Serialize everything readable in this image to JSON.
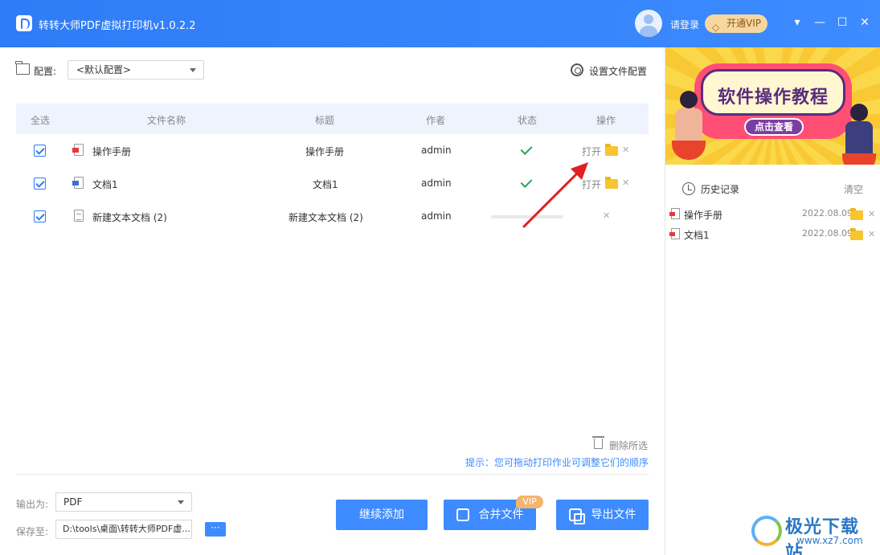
{
  "titlebar": {
    "app_title": "转转大师PDF虚拟打印机v1.0.2.2",
    "login_text": "请登录",
    "vip_label": "开通VIP",
    "controls": {
      "dropdown": "▾",
      "minimize": "—",
      "maximize": "☐",
      "close": "✕"
    }
  },
  "config": {
    "label": "配置:",
    "selected": "<默认配置>",
    "set_label": "设置文件配置"
  },
  "table": {
    "headers": [
      "全选",
      "文件名称",
      "标题",
      "作者",
      "状态",
      "操作"
    ],
    "rows": [
      {
        "name": "操作手册",
        "title": "操作手册",
        "author": "admin",
        "status": "done",
        "action": "打开",
        "file_type": "pdf"
      },
      {
        "name": "文档1",
        "title": "文档1",
        "author": "admin",
        "status": "done",
        "action": "打开",
        "file_type": "word"
      },
      {
        "name": "新建文本文档 (2)",
        "title": "新建文本文档 (2)",
        "author": "admin",
        "status": "progress",
        "action": "",
        "file_type": "txt"
      }
    ]
  },
  "footer": {
    "delete_selected": "删除所选",
    "hint": "提示：您可拖动打印作业可调整它们的顺序",
    "output_label": "输出为:",
    "output_format": "PDF",
    "save_label": "保存至:",
    "save_path": "D:\\tools\\桌面\\转转大师PDF虚...",
    "browse_label": "···",
    "continue_add": "继续添加",
    "merge_files": "合并文件",
    "export_files": "导出文件",
    "vip_tag": "VIP"
  },
  "sidebar": {
    "banner_title": "软件操作教程",
    "banner_button": "点击查看",
    "history_title": "历史记录",
    "history_clear": "清空",
    "history": [
      {
        "name": "操作手册",
        "date": "2022.08.09"
      },
      {
        "name": "文档1",
        "date": "2022.08.09"
      }
    ]
  },
  "watermark": {
    "text": "极光下载站",
    "url": "www.xz7.com"
  },
  "colors": {
    "accent": "#3d8bff",
    "success": "#22a55a",
    "vip": "#f7d7a0",
    "folder": "#f7c531"
  }
}
